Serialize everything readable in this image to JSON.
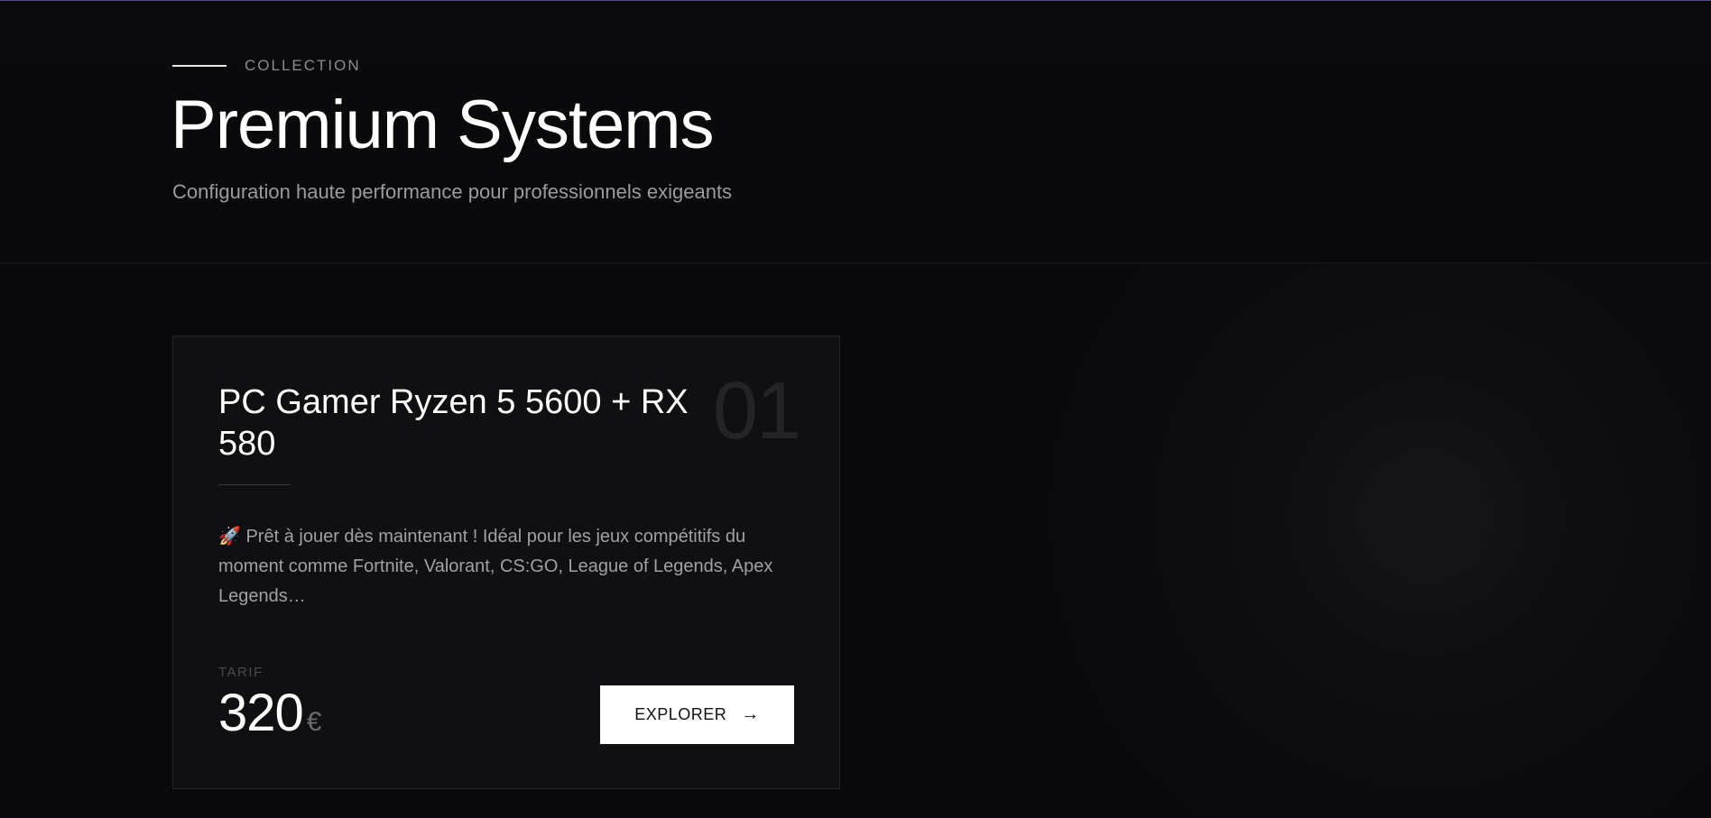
{
  "header": {
    "eyebrow": "COLLECTION",
    "title": "Premium Systems",
    "subtitle": "Configuration haute performance pour professionnels exigeants"
  },
  "products": [
    {
      "index": "01",
      "title": "PC Gamer Ryzen 5 5600 + RX 580",
      "description": "🚀 Prêt à jouer dès maintenant ! Idéal pour les jeux compétitifs du moment comme Fortnite, Valorant, CS:GO, League of Legends, Apex Legends…",
      "price_label": "TARIF",
      "price": "320",
      "currency": "€",
      "button_label": "EXPLORER",
      "button_icon": "arrow-right-icon"
    }
  ],
  "colors": {
    "background": "#0a0a0c",
    "card_background": "#101012",
    "accent_top": "#5b4a8a",
    "button_background": "#ffffff"
  }
}
